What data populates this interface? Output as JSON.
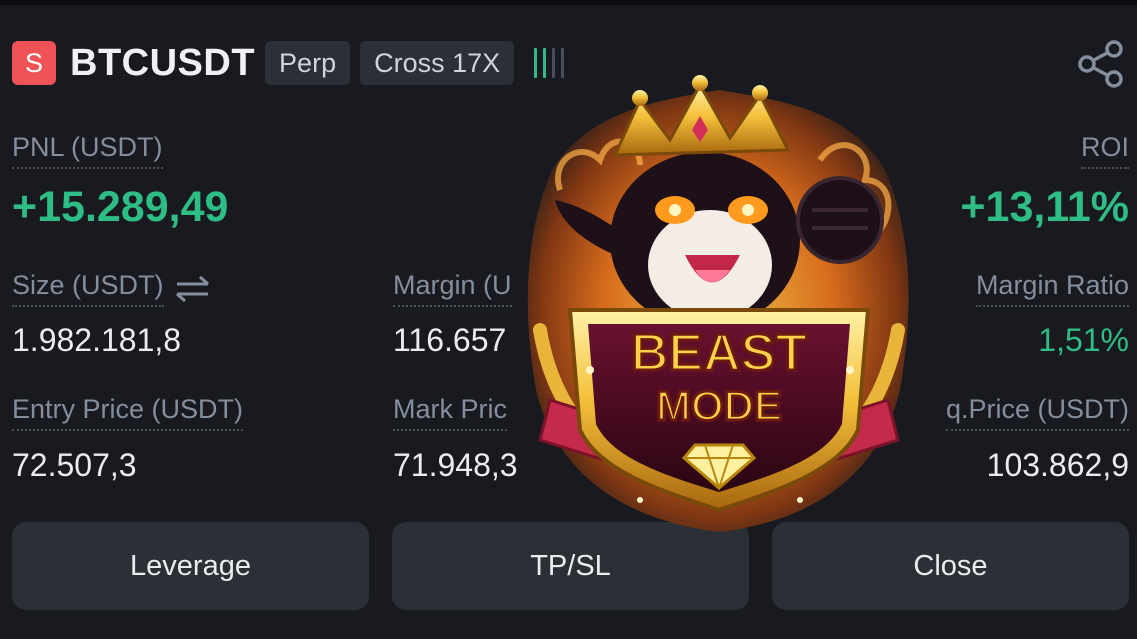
{
  "header": {
    "symbol_badge": "S",
    "symbol": "BTCUSDT",
    "tag_type": "Perp",
    "tag_margin": "Cross 17X"
  },
  "icons": {
    "share": "share-icon",
    "swap": "swap-arrows-icon",
    "signal": "signal-bars-icon"
  },
  "pnl": {
    "label": "PNL (USDT)",
    "value": "+15.289,49"
  },
  "roi": {
    "label": "ROI",
    "value": "+13,11%"
  },
  "size": {
    "label": "Size (USDT)",
    "value": "1.982.181,8"
  },
  "margin": {
    "label": "Margin (U",
    "value": "116.657"
  },
  "margin_ratio": {
    "label": "Margin Ratio",
    "value": "1,51%"
  },
  "entry_price": {
    "label": "Entry Price (USDT)",
    "value": "72.507,3"
  },
  "mark_price": {
    "label": "Mark Pric",
    "value": "71.948,3"
  },
  "liq_price": {
    "label": "q.Price (USDT)",
    "value": "103.862,9"
  },
  "buttons": {
    "leverage": "Leverage",
    "tpsl": "TP/SL",
    "close": "Close"
  },
  "sticker": {
    "line1": "BEAST",
    "line2": "MODE"
  },
  "colors": {
    "positive": "#2ebd85",
    "background": "#181a20",
    "panel": "#2b2f36",
    "badge": "#ef5358",
    "muted": "#848e9c"
  }
}
